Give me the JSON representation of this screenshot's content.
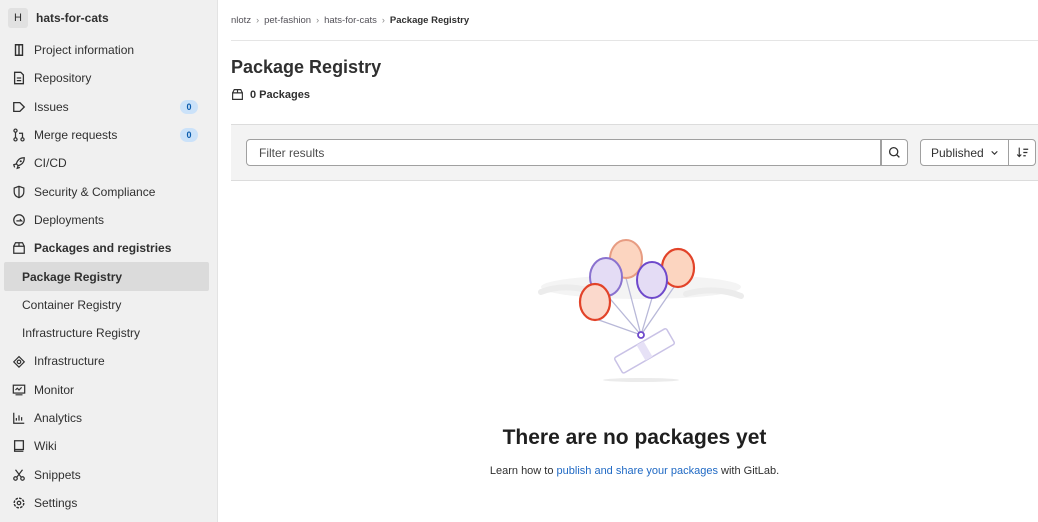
{
  "sidebar": {
    "project_avatar": "H",
    "project_name": "hats-for-cats",
    "items": [
      {
        "label": "Project information",
        "icon": "project-icon"
      },
      {
        "label": "Repository",
        "icon": "doc-icon"
      },
      {
        "label": "Issues",
        "icon": "issues-icon",
        "badge": "0"
      },
      {
        "label": "Merge requests",
        "icon": "merge-request-icon",
        "badge": "0"
      },
      {
        "label": "CI/CD",
        "icon": "rocket-icon"
      },
      {
        "label": "Security & Compliance",
        "icon": "shield-icon"
      },
      {
        "label": "Deployments",
        "icon": "deployments-icon"
      },
      {
        "label": "Packages and registries",
        "icon": "package-icon"
      },
      {
        "label": "Package Registry"
      },
      {
        "label": "Container Registry"
      },
      {
        "label": "Infrastructure Registry"
      },
      {
        "label": "Infrastructure",
        "icon": "cloud-gear-icon"
      },
      {
        "label": "Monitor",
        "icon": "monitor-icon"
      },
      {
        "label": "Analytics",
        "icon": "chart-icon"
      },
      {
        "label": "Wiki",
        "icon": "book-icon"
      },
      {
        "label": "Snippets",
        "icon": "scissors-icon"
      },
      {
        "label": "Settings",
        "icon": "settings-icon"
      }
    ]
  },
  "breadcrumb": {
    "items": [
      "nlotz",
      "pet-fashion",
      "hats-for-cats",
      "Package Registry"
    ],
    "separator": "›"
  },
  "page": {
    "title": "Package Registry",
    "package_count": "0 Packages"
  },
  "filter": {
    "placeholder": "Filter results",
    "sort_label": "Published"
  },
  "empty_state": {
    "title": "There are no packages yet",
    "desc_before": "Learn how to ",
    "link_text": "publish and share your packages",
    "desc_after": " with GitLab."
  },
  "colors": {
    "sidebar_bg": "#f0f0f0",
    "active_bg": "#dbdbdb",
    "badge_bg": "#cbe2f9",
    "link": "#1f69c4",
    "balloon_orange": "#e24329",
    "balloon_purple": "#6e49cb"
  }
}
